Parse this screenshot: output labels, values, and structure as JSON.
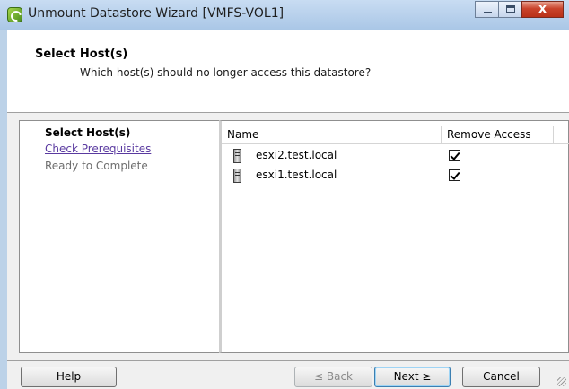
{
  "window": {
    "title": "Unmount Datastore Wizard [VMFS-VOL1]",
    "close_glyph": "x"
  },
  "header": {
    "title": "Select Host(s)",
    "subtitle": "Which host(s) should no longer access this datastore?"
  },
  "steps": [
    {
      "label": "Select Host(s)",
      "state": "current"
    },
    {
      "label": "Check Prerequisites",
      "state": "link"
    },
    {
      "label": "Ready to Complete",
      "state": "pending"
    }
  ],
  "table": {
    "columns": [
      "Name",
      "Remove Access"
    ],
    "rows": [
      {
        "name": "esxi2.test.local",
        "remove_access": true
      },
      {
        "name": "esxi1.test.local",
        "remove_access": true
      }
    ]
  },
  "buttons": {
    "help": "Help",
    "back": "≤ Back",
    "next": "Next ≥",
    "cancel": "Cancel"
  },
  "icons": {
    "app": "wizard-app-icon",
    "host": "server-icon"
  }
}
